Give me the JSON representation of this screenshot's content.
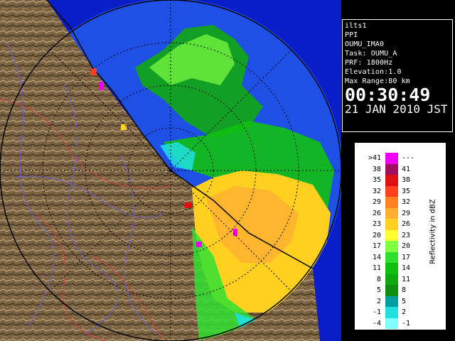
{
  "info": {
    "lines": [
      "ilts1",
      "PPI",
      "OUMU_IMA0",
      "Task: OUMU_A",
      "PRF: 1800Hz",
      "Elevation:1.0",
      "Max Range:80 km"
    ],
    "time": "00:30:49",
    "date": "21 JAN 2010 JST"
  },
  "legend": {
    "title": "Reflectivity in dBZ",
    "rows": [
      {
        "low": ">41",
        "high": "---",
        "color": "#f000f0"
      },
      {
        "low": "38",
        "high": "41",
        "color": "#a01060"
      },
      {
        "low": "35",
        "high": "38",
        "color": "#e01010"
      },
      {
        "low": "32",
        "high": "35",
        "color": "#ff4020"
      },
      {
        "low": "29",
        "high": "32",
        "color": "#ff8020"
      },
      {
        "low": "26",
        "high": "29",
        "color": "#ffb030"
      },
      {
        "low": "23",
        "high": "26",
        "color": "#ffd020"
      },
      {
        "low": "20",
        "high": "23",
        "color": "#ffff30"
      },
      {
        "low": "17",
        "high": "20",
        "color": "#80ff40"
      },
      {
        "low": "14",
        "high": "17",
        "color": "#30e030"
      },
      {
        "low": "11",
        "high": "14",
        "color": "#10c010"
      },
      {
        "low": "8",
        "high": "11",
        "color": "#10a810"
      },
      {
        "low": "5",
        "high": "8",
        "color": "#108c10"
      },
      {
        "low": "2",
        "high": "5",
        "color": "#00a0a0"
      },
      {
        "low": "-1",
        "high": "2",
        "color": "#20e0e0"
      },
      {
        "low": "-4",
        "high": "-1",
        "color": "#80ffff"
      }
    ]
  },
  "colors": {
    "sea": "#1e50e6",
    "deep_sea": "#0a1ec8",
    "land": "#7a6242",
    "range_ring": "#000000"
  }
}
